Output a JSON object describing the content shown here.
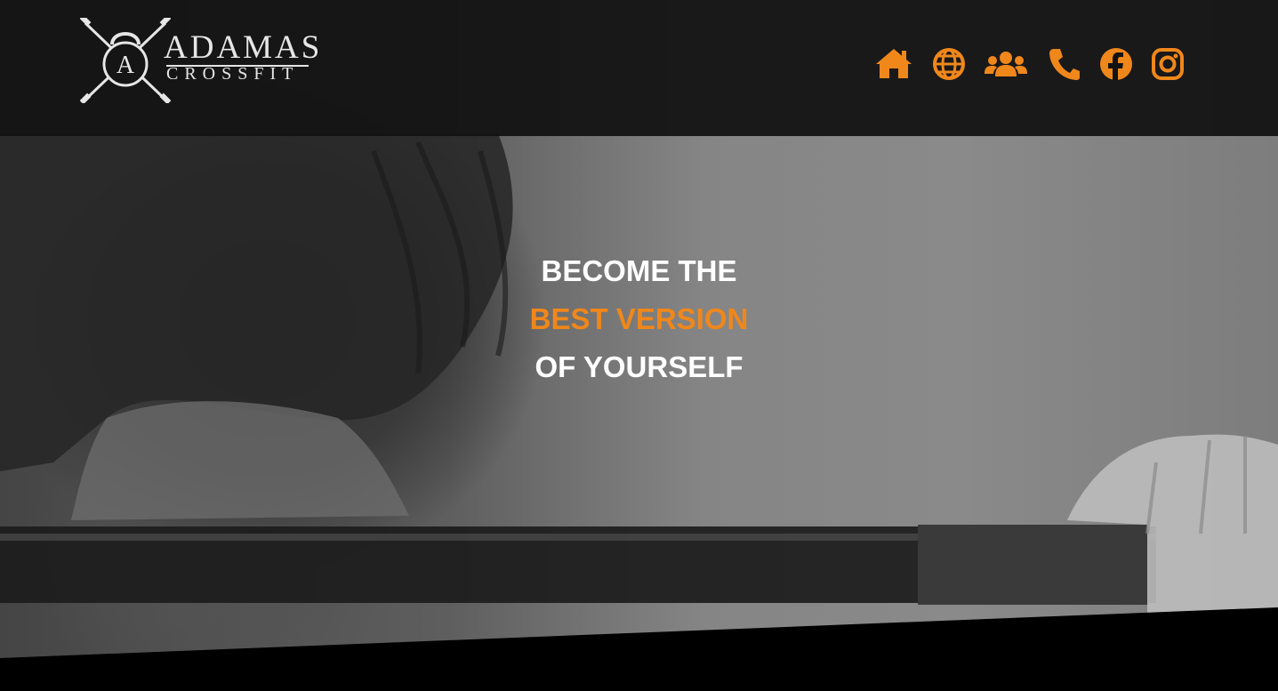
{
  "brand": {
    "name": "ADAMAS",
    "subtitle": "CROSSFIT",
    "emblem_letter": "A"
  },
  "nav": {
    "items": [
      {
        "icon": "home-icon",
        "label": "Home"
      },
      {
        "icon": "globe-icon",
        "label": "Website"
      },
      {
        "icon": "users-icon",
        "label": "Team"
      },
      {
        "icon": "phone-icon",
        "label": "Phone"
      },
      {
        "icon": "facebook-icon",
        "label": "Facebook"
      },
      {
        "icon": "instagram-icon",
        "label": "Instagram"
      }
    ]
  },
  "hero": {
    "line1": "BECOME THE",
    "line2": "BEST VERSION",
    "line3": "OF YOURSELF"
  },
  "colors": {
    "accent": "#f0871b",
    "header_bg": "#121212",
    "text": "#ffffff",
    "bottom_band": "#000000"
  }
}
